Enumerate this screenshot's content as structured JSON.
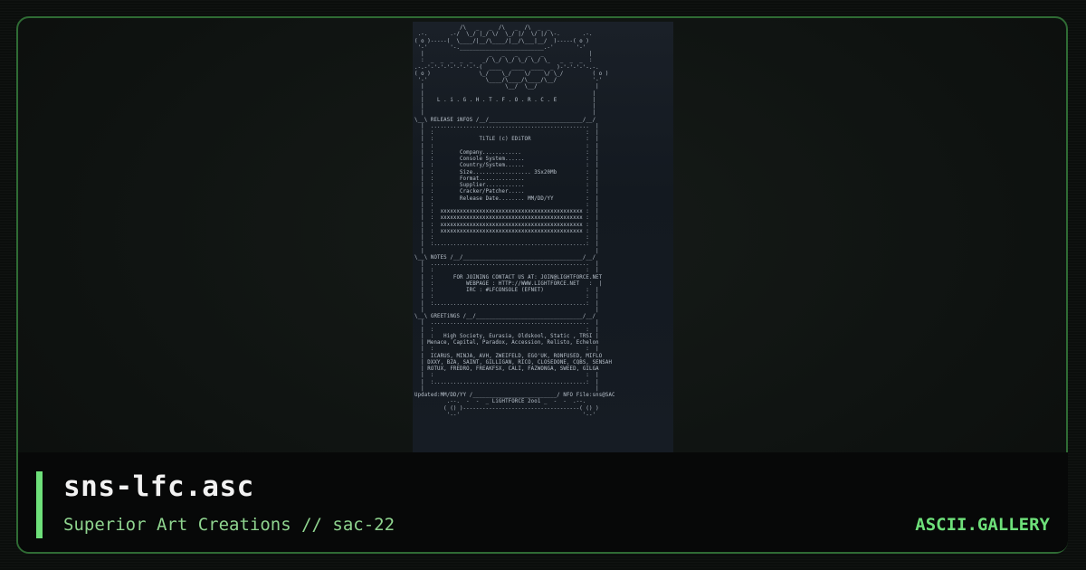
{
  "file": {
    "title": "sns-lfc.asc",
    "subtitle": "Superior Art Creations // sac-22"
  },
  "brand": "ASCII.GALLERY",
  "preview": {
    "ascii": "              /\\   _   _  /\\   _  /\\  _  _\n .-.       .-/  \\_/ |_/ \\/  \\_/ |/  \\/ |/ \\-.       .-.\n( o )-----(  \\____/|__/\\____/|__/\\___|__/  )-----( o )\n '-'       '-.__________________________.-'       '-'\n  |                    _   _   _   _   _              |\n  :  _  _  _  _  _   _/ \\_/ \\_/ \\_/ \\_/ \\_   _  _  _  :\n.-.-'-'-'-'-'-'-'-'-(  ____   ____  ____  _ )-'-'-'-'-.-.\n( o )               \\_/    \\_/    \\/    \\/ \\_/         ( o )\n '-'                  \\____/\\____/\\____/\\__/           '-'\n  |                         \\__/  \\__/                  |\n  |                                                    |\n  |    L . i . G . H . T . F . O . R . C . E           |\n  |                                                    |\n  |                                                    |\n\\__\\ RELEASE iNFOS /__/_____________________________/__/\n  |  .................................................  |\n  |  :                                               :  |\n  |  :              TiTLE (c) EDiTOR                 :  |\n  |  :                                               :  |\n  |  :        Company............                    :  |\n  |  :        Console System......                   :  |\n  |  :        Country/System......                   :  |\n  |  :        Size.................. 3Sx20Mb         :  |\n  |  :        Format..............                   :  |\n  |  :        Supplier............                   :  |\n  |  :        Cracker/Patcher.....                   :  |\n  |  :        Release Date........ MM/DD/YY          :  |\n  |  :                                               :  |\n  |  :  xxxxxxxxxxxxxxxxxxxxxxxxxxxxxxxxxxxxxxxxxxxx :  |\n  |  :  xxxxxxxxxxxxxxxxxxxxxxxxxxxxxxxxxxxxxxxxxxxx :  |\n  |  :  xxxxxxxxxxxxxxxxxxxxxxxxxxxxxxxxxxxxxxxxxxxx :  |\n  |  :  xxxxxxxxxxxxxxxxxxxxxxxxxxxxxxxxxxxxxxxxxxxx :  |\n  |  :                                               :  |\n  |  :...............................................:  |\n  |                                                     |\n\\__\\ NOTES /__/_____________________________________/__/\n  |  .................................................  |\n  |  :                                               :  |\n  |  :      FOR JOINING CONTACT US AT: JOIN@LIGHTFORCE.NET\n  |  :          WEBPAGE : HTTP://WWW.LIGHTFORCE.NET   :  |\n  |  :          IRC : #LFCONSOLE (EFNET)             :  |\n  |  :                                               :  |\n  |  :...............................................:  |\n  |                                                     |\n\\__\\ GREETiNGS /__/_________________________________/__/\n  |  .................................................  |\n  |  :                                               :  |\n  |  :   High Society, Eurasia, Oldskool, Static , TRSI |\n  | Menace, Capital, Paradox, Accession, Relisto, Echelon\n  |  :                                               :  |\n  |  ICARUS, MINJA, AVH, ZWEIFELD, EGO'UK, RONFUSED, MIFLO\n  | DXXY, BZA, SAINT, GILLIGAN, RICO, CLOSEDONE, CQBS, SENSAH\n  | ROTUX, FREDRO, FREAKFSX, CALI, FAZWONGA, SWEED, GILGA\n  |  :                                               :  |\n  |  :...............................................:  |\n  |                                                     |\nUpdated:MM/DD/YY /__________________________/ NFO File:sns@SAC\n          .--.  -  -  _ LiGHTFORCE 2oo1 _  -  -  .--.\n         ( () )------------------------------------( () )\n          '--'                                      '--'"
  }
}
